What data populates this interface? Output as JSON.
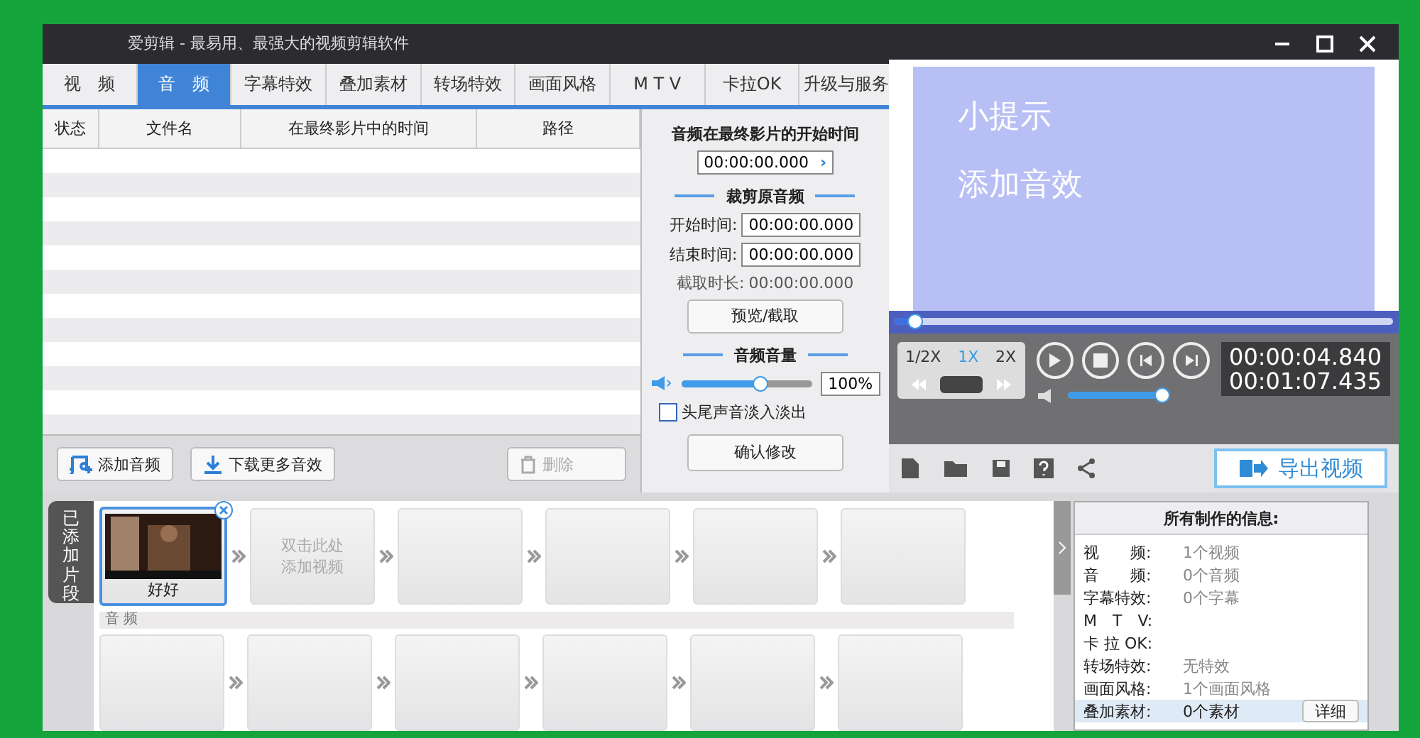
{
  "window": {
    "title": "爱剪辑 - 最易用、最强大的视频剪辑软件"
  },
  "tabs": [
    {
      "label": "视　频",
      "selected": false
    },
    {
      "label": "音　频",
      "selected": true
    },
    {
      "label": "字幕特效",
      "selected": false
    },
    {
      "label": "叠加素材",
      "selected": false
    },
    {
      "label": "转场特效",
      "selected": false
    },
    {
      "label": "画面风格",
      "selected": false
    },
    {
      "label": "M T V",
      "selected": false
    },
    {
      "label": "卡拉OK",
      "selected": false
    },
    {
      "label": "升级与服务",
      "selected": false
    }
  ],
  "audio_table": {
    "columns": [
      "状态",
      "文件名",
      "在最终影片中的时间",
      "路径"
    ]
  },
  "audio_buttons": {
    "add": "添加音频",
    "download": "下载更多音效",
    "delete": "删除",
    "delete_disabled": true
  },
  "audio_settings": {
    "start_title": "音频在最终影片的开始时间",
    "start_value": "00:00:00.000",
    "arrow": "›",
    "trim_title": "裁剪原音频",
    "start_label": "开始时间:",
    "start_time": "00:00:00.000",
    "end_label": "结束时间:",
    "end_time": "00:00:00.000",
    "duration_label": "截取时长:",
    "duration": "00:00:00.000",
    "preview_button": "预览/截取",
    "volume_title": "音频音量",
    "volume": {
      "level": 0.6
    },
    "volume_value": "100%",
    "fade": {
      "label": "头尾声音淡入淡出",
      "checked": false
    },
    "confirm_button": "确认修改"
  },
  "preview": {
    "tip_title": "小提示",
    "tip_text": "添加音效",
    "progress": {
      "level": 0.04
    }
  },
  "player": {
    "speeds": [
      {
        "label": "1/2X",
        "selected": false
      },
      {
        "label": "1X",
        "selected": true
      },
      {
        "label": "2X",
        "selected": false
      }
    ],
    "volume": {
      "level": 0.95
    },
    "current_time": "00:00:04.840",
    "total_time": "00:01:07.435",
    "export_button": "导出视频"
  },
  "clips_tab": "已添加片段",
  "video_clips": [
    {
      "kind": "clip",
      "label": "好好"
    },
    {
      "kind": "placeholder",
      "text": "双击此处添加视频"
    },
    {
      "kind": "empty"
    },
    {
      "kind": "empty"
    },
    {
      "kind": "empty"
    },
    {
      "kind": "empty"
    }
  ],
  "audio_label": "音 频",
  "audio_clips": [
    {
      "kind": "empty"
    },
    {
      "kind": "empty"
    },
    {
      "kind": "empty"
    },
    {
      "kind": "empty"
    },
    {
      "kind": "empty"
    },
    {
      "kind": "empty"
    }
  ],
  "info": {
    "title": "所有制作的信息:",
    "rows": [
      {
        "label": "视　　频:",
        "value": "1个视频"
      },
      {
        "label": "音　　频:",
        "value": "0个音频"
      },
      {
        "label": "字幕特效:",
        "value": "0个字幕"
      },
      {
        "label": "M　T　V:"
      },
      {
        "label": "卡 拉 OK:"
      },
      {
        "label": "转场特效:",
        "value": "无特效"
      },
      {
        "label": "画面风格:",
        "value": "1个画面风格"
      },
      {
        "label": "叠加素材:",
        "value": "0个素材",
        "button": "详细"
      }
    ]
  }
}
